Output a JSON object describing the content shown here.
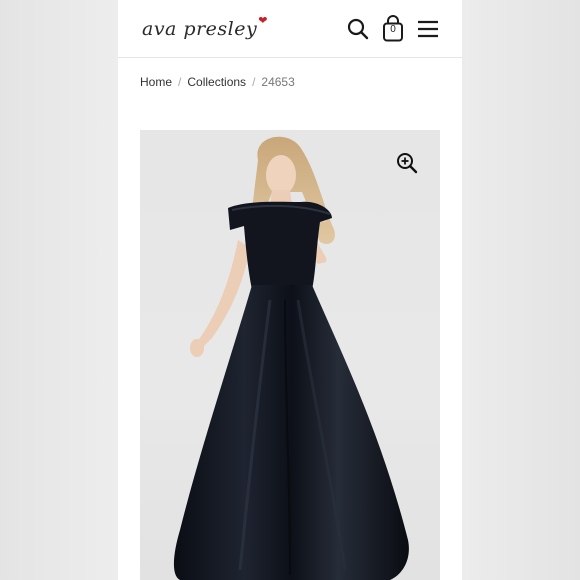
{
  "brand": {
    "logo_text": "ava presley"
  },
  "header": {
    "cart_count": "0",
    "icons": [
      "search-icon",
      "shopping-bag-icon",
      "menu-icon"
    ]
  },
  "breadcrumb": {
    "items": [
      "Home",
      "Collections",
      "24653"
    ],
    "separator": "/"
  },
  "product": {
    "image_alt_icon": "zoom-in-icon"
  },
  "colors": {
    "accent_heart": "#c8202a",
    "text": "#333333",
    "dress": "#0f1219"
  }
}
